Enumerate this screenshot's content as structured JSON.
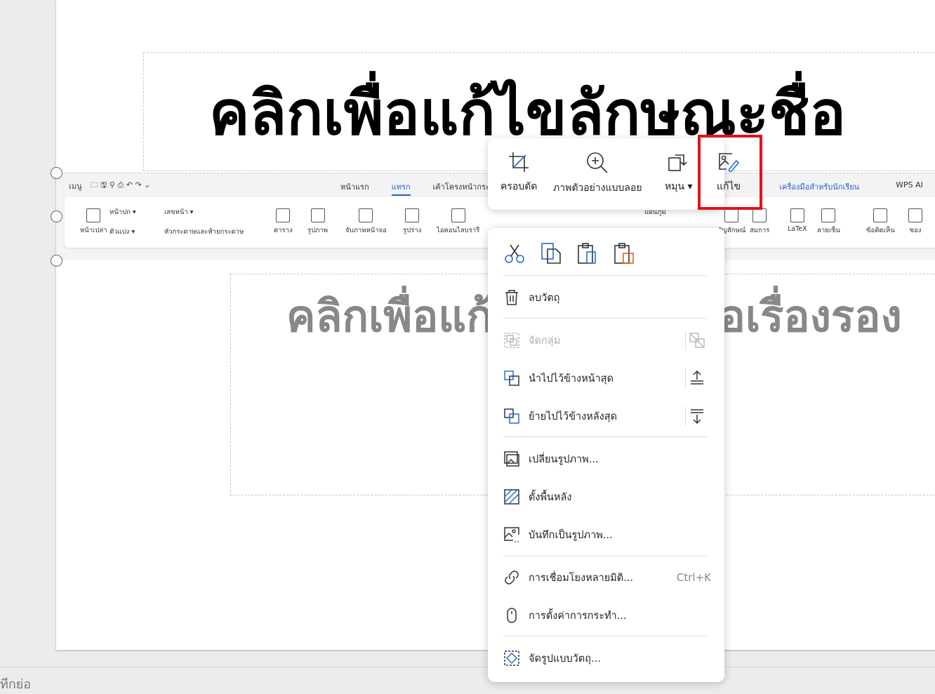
{
  "slide": {
    "title_placeholder": "คลิกเพื่อแก้ไขลักษณะชื่อ",
    "subtitle_placeholder": "คลิกเพื่อแก้ไขลักษณะชื่อเรื่องรอง"
  },
  "status": {
    "notes": "ทีกย่อ"
  },
  "ribbon_image": {
    "menu": "เมนู",
    "tabs": [
      "หน้าแรก",
      "แทรก",
      "เค้าโครงหน้ากระดาษ",
      "เครื่องมือสำหรับนักเรียน",
      "WPS AI"
    ],
    "groups": {
      "blank_page": "หน้าเปล่า",
      "cover": "หน้าปก",
      "page_number": "เลขหน้า",
      "divider": "ตัวแบ่ง",
      "header_footer": "หัวกระดาษและท้ายกระดาษ",
      "table": "ตาราง",
      "picture": "รูปภาพ",
      "screenshot": "จับภาพหน้าจอ",
      "shape": "รูปร่าง",
      "icon_library": "ไอคอนไลบรารี",
      "chart": "แผนภูมิ",
      "symbol": "สัญลักษณ์",
      "equation": "สมการ",
      "latex": "LaTeX",
      "ink": "ลายเซ็น",
      "comment": "ข้อคิดเห็น",
      "envelope": "ซอง"
    }
  },
  "floating_toolbar": {
    "crop": "ครอบตัด",
    "preview": "ภาพตัวอย่างแบบลอย",
    "rotate": "หมุน",
    "edit": "แก้ไข",
    "highlight_color": "#e0141e"
  },
  "context_menu": {
    "delete": "ลบวัตถุ",
    "group": "จัดกลุ่ม",
    "bring_to_front": "นำไปไว้ข้างหน้าสุด",
    "send_to_back": "ย้ายไปไว้ข้างหลังสุด",
    "change_picture": "เปลี่ยนรูปภาพ...",
    "set_background": "ตั้งพื้นหลัง",
    "save_as_picture": "บันทึกเป็นรูปภาพ...",
    "hyperlink": "การเชื่อมโยงหลายมิติ...",
    "hyperlink_shortcut": "Ctrl+K",
    "action_settings": "การตั้งค่าการกระทำ...",
    "format_object": "จัดรูปแบบวัตถุ..."
  }
}
